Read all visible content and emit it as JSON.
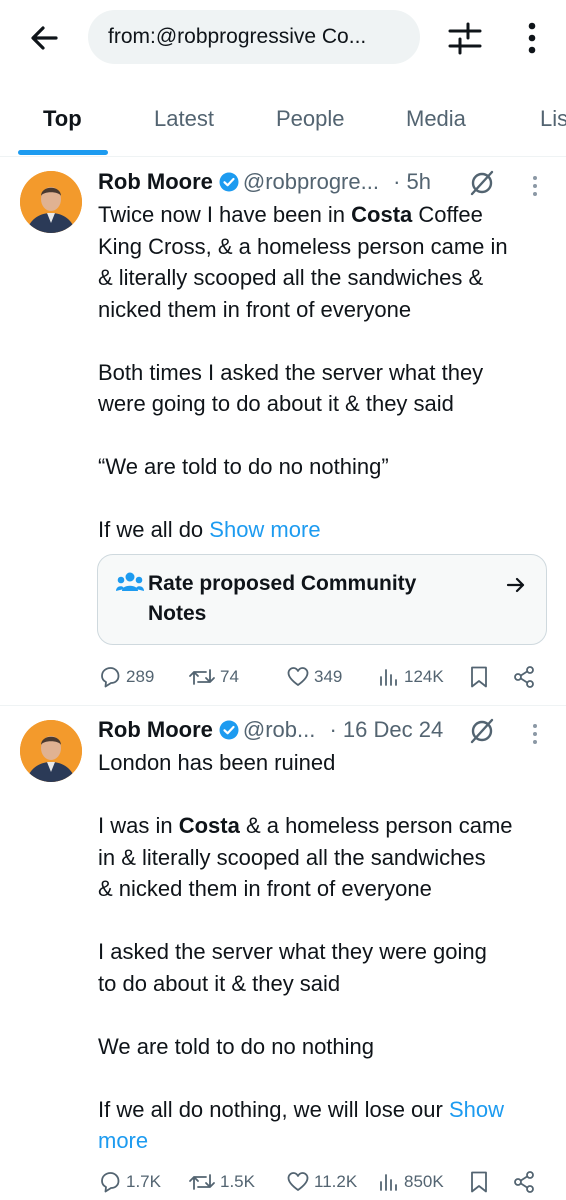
{
  "search": {
    "query": "from:@robprogressive Co..."
  },
  "tabs": [
    "Top",
    "Latest",
    "People",
    "Media",
    "Lis"
  ],
  "colors": {
    "accent": "#1d9bf0",
    "text": "#0f1419",
    "muted": "#536471",
    "avatar_bg": "#f39a2c"
  },
  "tweets": [
    {
      "name": "Rob Moore",
      "handle": "@robprogre...",
      "time": "· 5h",
      "lines": [
        [
          "Twice now I have been in ",
          "Costa",
          " Coffee"
        ],
        [
          "King Cross, & a homeless person came in"
        ],
        [
          "& literally scooped all the sandwiches &"
        ],
        [
          "nicked them in front of everyone"
        ],
        [
          ""
        ],
        [
          "Both times I asked the server what they"
        ],
        [
          "were going to do about it & they said"
        ],
        [
          ""
        ],
        [
          "“We are told to do no nothing”"
        ],
        [
          ""
        ],
        [
          "If we all do "
        ]
      ],
      "show_more": "Show more",
      "note": {
        "label": "Rate proposed Community Notes"
      },
      "stats": {
        "replies": "289",
        "reposts": "74",
        "likes": "349",
        "views": "124K"
      }
    },
    {
      "name": "Rob Moore",
      "handle": "@rob...",
      "time": "· 16 Dec 24",
      "lines": [
        [
          "London has been ruined"
        ],
        [
          ""
        ],
        [
          "I was in ",
          "Costa",
          " & a homeless person came"
        ],
        [
          "in & literally scooped all the sandwiches"
        ],
        [
          "& nicked them in front of everyone"
        ],
        [
          ""
        ],
        [
          "I asked the server what they were going"
        ],
        [
          "to do about it & they said"
        ],
        [
          ""
        ],
        [
          "We are told to do no nothing"
        ],
        [
          ""
        ],
        [
          "If we all do nothing, we will lose our "
        ]
      ],
      "show_more_a": "Show",
      "show_more_b": "more",
      "stats": {
        "replies": "1.7K",
        "reposts": "1.5K",
        "likes": "11.2K",
        "views": "850K"
      }
    }
  ]
}
